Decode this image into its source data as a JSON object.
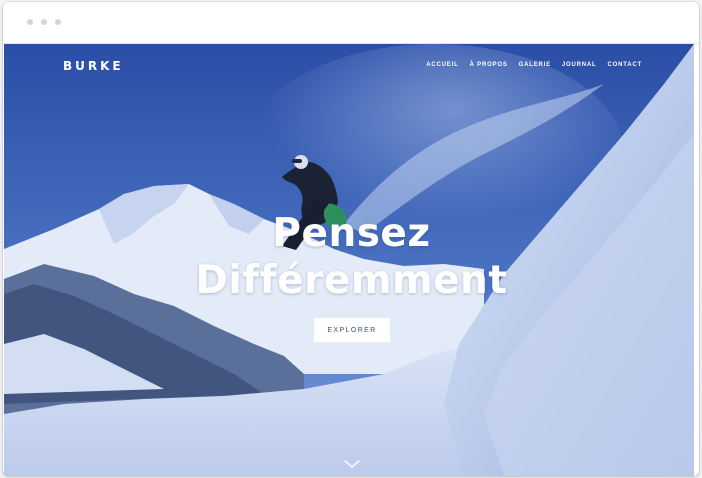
{
  "site": {
    "brand": "BURKE"
  },
  "nav": {
    "items": [
      {
        "label": "ACCUEIL"
      },
      {
        "label": "À PROPOS"
      },
      {
        "label": "GALERIE"
      },
      {
        "label": "JOURNAL"
      },
      {
        "label": "CONTACT"
      }
    ]
  },
  "hero": {
    "headline_line1": "Pensez",
    "headline_line2": "Différemment",
    "cta_label": "EXPLORER",
    "scroll_icon": "chevron-down-icon",
    "background": "snowboarder-mountain-photo"
  },
  "colors": {
    "overlay": "#3f63b4",
    "text": "#ffffff",
    "button_bg": "#ffffff",
    "button_text": "#3d4e6e"
  }
}
